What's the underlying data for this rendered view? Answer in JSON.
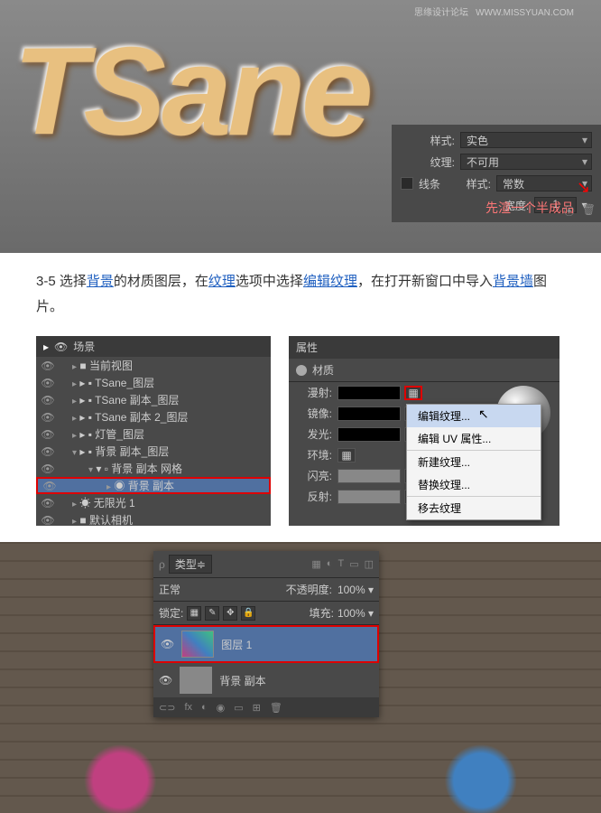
{
  "watermark": {
    "text": "思缘设计论坛",
    "url": "WWW.MISSYUAN.COM"
  },
  "text3d": "TSane",
  "props": {
    "styleLabel": "样式:",
    "styleVal": "实色",
    "textureLabel": "纹理:",
    "textureVal": "不可用",
    "lineLabel": "线条",
    "lineStyleLabel": "样式:",
    "lineStyleVal": "常数",
    "widthLabel": "宽度:",
    "widthVal": "1",
    "anno": "先渲一个半成品"
  },
  "instruction": {
    "num": "3-5",
    "t1": "选择",
    "b1": "背景",
    "t2": "的材质图层，在",
    "b2": "纹理",
    "t3": "选项中选择",
    "b3": "编辑纹理",
    "t4": "，在打开新窗口中导入",
    "b4": "背景墙",
    "t5": "图片。"
  },
  "scene": {
    "hdr": "场景",
    "items": [
      {
        "name": "当前视图",
        "indent": 1,
        "icon": "cam"
      },
      {
        "name": "TSane_图层",
        "indent": 1,
        "icon": "fold"
      },
      {
        "name": "TSane 副本_图层",
        "indent": 1,
        "icon": "fold"
      },
      {
        "name": "TSane 副本 2_图层",
        "indent": 1,
        "icon": "fold"
      },
      {
        "name": "灯管_图层",
        "indent": 1,
        "icon": "fold"
      },
      {
        "name": "背景 副本_图层",
        "indent": 1,
        "icon": "fold",
        "open": true
      },
      {
        "name": "背景 副本 网格",
        "indent": 2,
        "icon": "mesh",
        "open": true
      },
      {
        "name": "背景 副本",
        "indent": 3,
        "icon": "mat",
        "sel": true,
        "red": true
      },
      {
        "name": "无限光 1",
        "indent": 1,
        "icon": "light"
      },
      {
        "name": "默认相机",
        "indent": 1,
        "icon": "cam"
      }
    ]
  },
  "material": {
    "hdr": "属性",
    "tab": "材质",
    "rows": [
      {
        "label": "漫射:",
        "swatch": true,
        "iconRed": true
      },
      {
        "label": "镜像:",
        "swatch": true
      },
      {
        "label": "发光:",
        "swatch": true
      },
      {
        "label": "环境:"
      },
      {
        "label": "闪亮:",
        "grey": true
      },
      {
        "label": "反射:",
        "grey": true
      }
    ],
    "menu": [
      "编辑纹理...",
      "编辑 UV 属性...",
      "新建纹理...",
      "替换纹理...",
      "移去纹理"
    ]
  },
  "layers": {
    "typeLabel": "类型",
    "mode": "正常",
    "opacityLabel": "不透明度:",
    "opacityVal": "100%",
    "lockLabel": "锁定:",
    "fillLabel": "填充:",
    "fillVal": "100%",
    "items": [
      {
        "name": "图层 1",
        "img": true,
        "sel": true,
        "red": true
      },
      {
        "name": "背景 副本",
        "img": false
      }
    ]
  }
}
